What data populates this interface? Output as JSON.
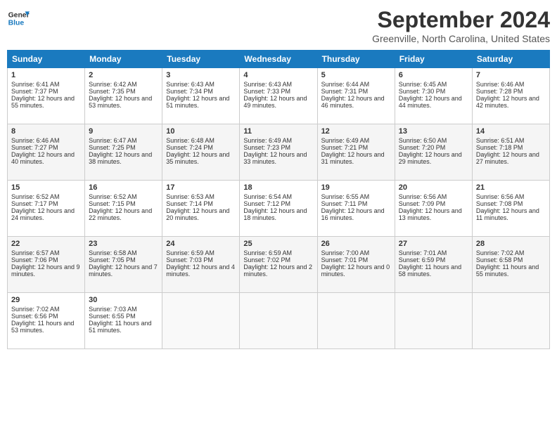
{
  "logo": {
    "line1": "General",
    "line2": "Blue"
  },
  "title": "September 2024",
  "subtitle": "Greenville, North Carolina, United States",
  "days_header": [
    "Sunday",
    "Monday",
    "Tuesday",
    "Wednesday",
    "Thursday",
    "Friday",
    "Saturday"
  ],
  "weeks": [
    [
      {
        "day": "1",
        "sunrise": "6:41 AM",
        "sunset": "7:37 PM",
        "daylight": "12 hours and 55 minutes."
      },
      {
        "day": "2",
        "sunrise": "6:42 AM",
        "sunset": "7:35 PM",
        "daylight": "12 hours and 53 minutes."
      },
      {
        "day": "3",
        "sunrise": "6:43 AM",
        "sunset": "7:34 PM",
        "daylight": "12 hours and 51 minutes."
      },
      {
        "day": "4",
        "sunrise": "6:43 AM",
        "sunset": "7:33 PM",
        "daylight": "12 hours and 49 minutes."
      },
      {
        "day": "5",
        "sunrise": "6:44 AM",
        "sunset": "7:31 PM",
        "daylight": "12 hours and 46 minutes."
      },
      {
        "day": "6",
        "sunrise": "6:45 AM",
        "sunset": "7:30 PM",
        "daylight": "12 hours and 44 minutes."
      },
      {
        "day": "7",
        "sunrise": "6:46 AM",
        "sunset": "7:28 PM",
        "daylight": "12 hours and 42 minutes."
      }
    ],
    [
      {
        "day": "8",
        "sunrise": "6:46 AM",
        "sunset": "7:27 PM",
        "daylight": "12 hours and 40 minutes."
      },
      {
        "day": "9",
        "sunrise": "6:47 AM",
        "sunset": "7:25 PM",
        "daylight": "12 hours and 38 minutes."
      },
      {
        "day": "10",
        "sunrise": "6:48 AM",
        "sunset": "7:24 PM",
        "daylight": "12 hours and 35 minutes."
      },
      {
        "day": "11",
        "sunrise": "6:49 AM",
        "sunset": "7:23 PM",
        "daylight": "12 hours and 33 minutes."
      },
      {
        "day": "12",
        "sunrise": "6:49 AM",
        "sunset": "7:21 PM",
        "daylight": "12 hours and 31 minutes."
      },
      {
        "day": "13",
        "sunrise": "6:50 AM",
        "sunset": "7:20 PM",
        "daylight": "12 hours and 29 minutes."
      },
      {
        "day": "14",
        "sunrise": "6:51 AM",
        "sunset": "7:18 PM",
        "daylight": "12 hours and 27 minutes."
      }
    ],
    [
      {
        "day": "15",
        "sunrise": "6:52 AM",
        "sunset": "7:17 PM",
        "daylight": "12 hours and 24 minutes."
      },
      {
        "day": "16",
        "sunrise": "6:52 AM",
        "sunset": "7:15 PM",
        "daylight": "12 hours and 22 minutes."
      },
      {
        "day": "17",
        "sunrise": "6:53 AM",
        "sunset": "7:14 PM",
        "daylight": "12 hours and 20 minutes."
      },
      {
        "day": "18",
        "sunrise": "6:54 AM",
        "sunset": "7:12 PM",
        "daylight": "12 hours and 18 minutes."
      },
      {
        "day": "19",
        "sunrise": "6:55 AM",
        "sunset": "7:11 PM",
        "daylight": "12 hours and 16 minutes."
      },
      {
        "day": "20",
        "sunrise": "6:56 AM",
        "sunset": "7:09 PM",
        "daylight": "12 hours and 13 minutes."
      },
      {
        "day": "21",
        "sunrise": "6:56 AM",
        "sunset": "7:08 PM",
        "daylight": "12 hours and 11 minutes."
      }
    ],
    [
      {
        "day": "22",
        "sunrise": "6:57 AM",
        "sunset": "7:06 PM",
        "daylight": "12 hours and 9 minutes."
      },
      {
        "day": "23",
        "sunrise": "6:58 AM",
        "sunset": "7:05 PM",
        "daylight": "12 hours and 7 minutes."
      },
      {
        "day": "24",
        "sunrise": "6:59 AM",
        "sunset": "7:03 PM",
        "daylight": "12 hours and 4 minutes."
      },
      {
        "day": "25",
        "sunrise": "6:59 AM",
        "sunset": "7:02 PM",
        "daylight": "12 hours and 2 minutes."
      },
      {
        "day": "26",
        "sunrise": "7:00 AM",
        "sunset": "7:01 PM",
        "daylight": "12 hours and 0 minutes."
      },
      {
        "day": "27",
        "sunrise": "7:01 AM",
        "sunset": "6:59 PM",
        "daylight": "11 hours and 58 minutes."
      },
      {
        "day": "28",
        "sunrise": "7:02 AM",
        "sunset": "6:58 PM",
        "daylight": "11 hours and 55 minutes."
      }
    ],
    [
      {
        "day": "29",
        "sunrise": "7:02 AM",
        "sunset": "6:56 PM",
        "daylight": "11 hours and 53 minutes."
      },
      {
        "day": "30",
        "sunrise": "7:03 AM",
        "sunset": "6:55 PM",
        "daylight": "11 hours and 51 minutes."
      },
      null,
      null,
      null,
      null,
      null
    ]
  ]
}
